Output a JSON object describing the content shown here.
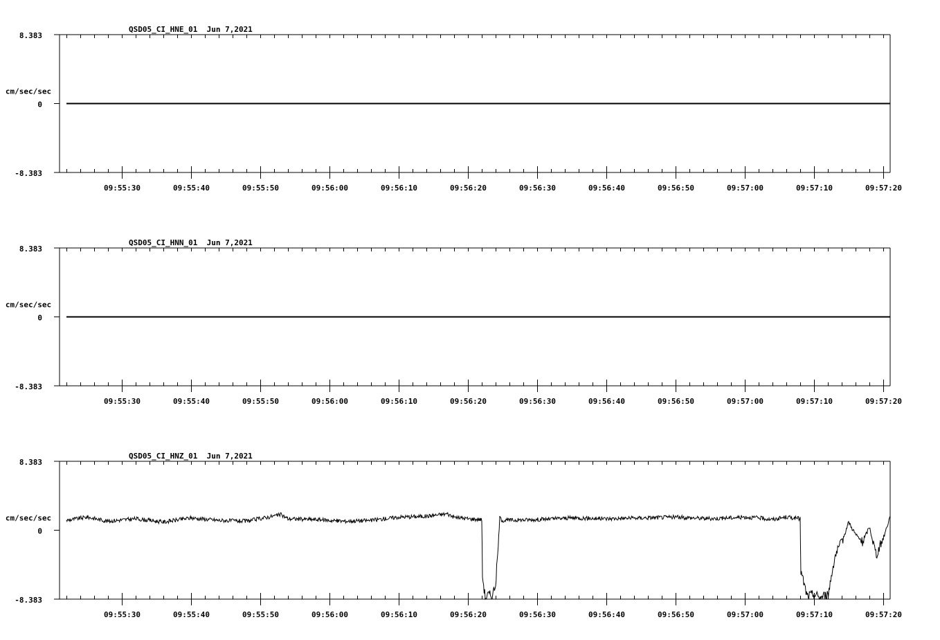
{
  "chart_data": [
    {
      "type": "line",
      "title": "QSD05_CI_HNE_01  Jun 7,2021",
      "ylabel": "cm/sec/sec",
      "ylim": [
        -8.383,
        8.383
      ],
      "y_tick_labels": [
        "8.383",
        "0",
        "-8.383"
      ],
      "xlim_seconds_after_09_55_20": [
        1,
        121
      ],
      "x_tick_labels": [
        "09:55:30",
        "09:55:40",
        "09:55:50",
        "09:56:00",
        "09:56:10",
        "09:56:20",
        "09:56:30",
        "09:56:40",
        "09:56:50",
        "09:57:00",
        "09:57:10",
        "09:57:20"
      ],
      "series": [
        {
          "x_seconds_after_09_55_20": [
            2,
            121
          ],
          "y": [
            0.0,
            0.0
          ]
        }
      ],
      "grid": false
    },
    {
      "type": "line",
      "title": "QSD05_CI_HNN_01  Jun 7,2021",
      "ylabel": "cm/sec/sec",
      "ylim": [
        -8.383,
        8.383
      ],
      "y_tick_labels": [
        "8.383",
        "0",
        "-8.383"
      ],
      "xlim_seconds_after_09_55_20": [
        1,
        121
      ],
      "x_tick_labels": [
        "09:55:30",
        "09:55:40",
        "09:55:50",
        "09:56:00",
        "09:56:10",
        "09:56:20",
        "09:56:30",
        "09:56:40",
        "09:56:50",
        "09:57:00",
        "09:57:10",
        "09:57:20"
      ],
      "series": [
        {
          "x_seconds_after_09_55_20": [
            2,
            121
          ],
          "y": [
            0.0,
            0.0
          ]
        }
      ],
      "grid": false
    },
    {
      "type": "line",
      "title": "QSD05_CI_HNZ_01  Jun 7,2021",
      "ylabel": "cm/sec/sec",
      "ylim": [
        -8.383,
        8.383
      ],
      "y_tick_labels": [
        "8.383",
        "0",
        "-8.383"
      ],
      "xlim_seconds_after_09_55_20": [
        1,
        121
      ],
      "x_tick_labels": [
        "09:55:30",
        "09:55:40",
        "09:55:50",
        "09:56:00",
        "09:56:10",
        "09:56:20",
        "09:56:30",
        "09:56:40",
        "09:56:50",
        "09:57:00",
        "09:57:10",
        "09:57:20"
      ],
      "series": [
        {
          "x_seconds_after_09_55_20": [
            2,
            5,
            8,
            12,
            16,
            20,
            24,
            28,
            33,
            34,
            38,
            42,
            46,
            50,
            54,
            57,
            58,
            60,
            62,
            62.1,
            62.5,
            63,
            63.5,
            64,
            64.3,
            64.6,
            65,
            70,
            75,
            80,
            85,
            90,
            95,
            100,
            102,
            104,
            106,
            108,
            108.1,
            109,
            110,
            111,
            111.5,
            112,
            113,
            114,
            115,
            116,
            117,
            118,
            119,
            120,
            121
          ],
          "y": [
            1.2,
            1.6,
            1.1,
            1.4,
            1.0,
            1.5,
            1.2,
            1.1,
            1.9,
            1.4,
            1.3,
            1.1,
            1.2,
            1.6,
            1.7,
            2.0,
            1.6,
            1.4,
            1.3,
            -5.5,
            -8.2,
            -7.8,
            -8.0,
            -6.5,
            -3.0,
            1.5,
            1.2,
            1.3,
            1.5,
            1.4,
            1.5,
            1.6,
            1.4,
            1.6,
            1.5,
            1.3,
            1.6,
            1.4,
            -5.0,
            -8.0,
            -7.8,
            -8.2,
            -7.9,
            -8.0,
            -3.2,
            -1.5,
            1.0,
            -0.5,
            -1.5,
            0.4,
            -3.0,
            -1.0,
            1.7
          ]
        }
      ],
      "grid": false
    }
  ]
}
